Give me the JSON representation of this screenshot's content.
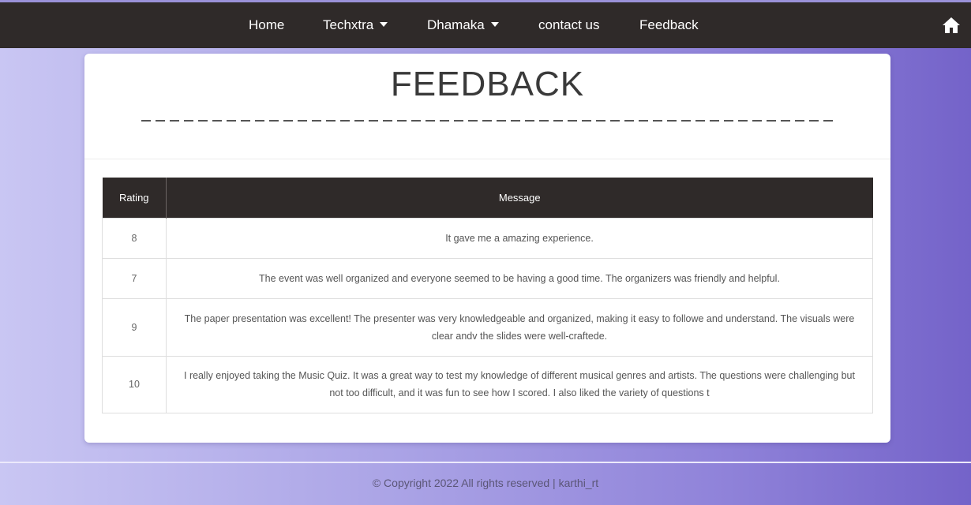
{
  "nav": {
    "items": [
      {
        "label": "Home",
        "dropdown": false
      },
      {
        "label": "Techxtra",
        "dropdown": true
      },
      {
        "label": "Dhamaka",
        "dropdown": true
      },
      {
        "label": "contact us",
        "dropdown": false
      },
      {
        "label": "Feedback",
        "dropdown": false
      }
    ],
    "home_icon": "home-icon"
  },
  "page": {
    "title": "FEEDBACK"
  },
  "table": {
    "headers": [
      "Rating",
      "Message"
    ],
    "rows": [
      {
        "rating": "8",
        "message": "It gave me a amazing experience."
      },
      {
        "rating": "7",
        "message": "The event was well organized and everyone seemed to be having a good time. The organizers was friendly and helpful."
      },
      {
        "rating": "9",
        "message": "The paper presentation was excellent! The presenter was very knowledgeable and organized, making it easy to followe and understand. The visuals were clear andv the slides were well-craftede."
      },
      {
        "rating": "10",
        "message": "I really enjoyed taking the Music Quiz. It was a great way to test my knowledge of different musical genres and artists. The questions were challenging but not too difficult, and it was fun to see how I scored. I also liked the variety of questions t"
      }
    ]
  },
  "footer": {
    "text": "© Copyright  2022 All rights reserved | karthi_rt"
  },
  "colors": {
    "navbar": "#2f2a29",
    "gradient_start": "#c9c6f3",
    "gradient_end": "#7463c9"
  }
}
